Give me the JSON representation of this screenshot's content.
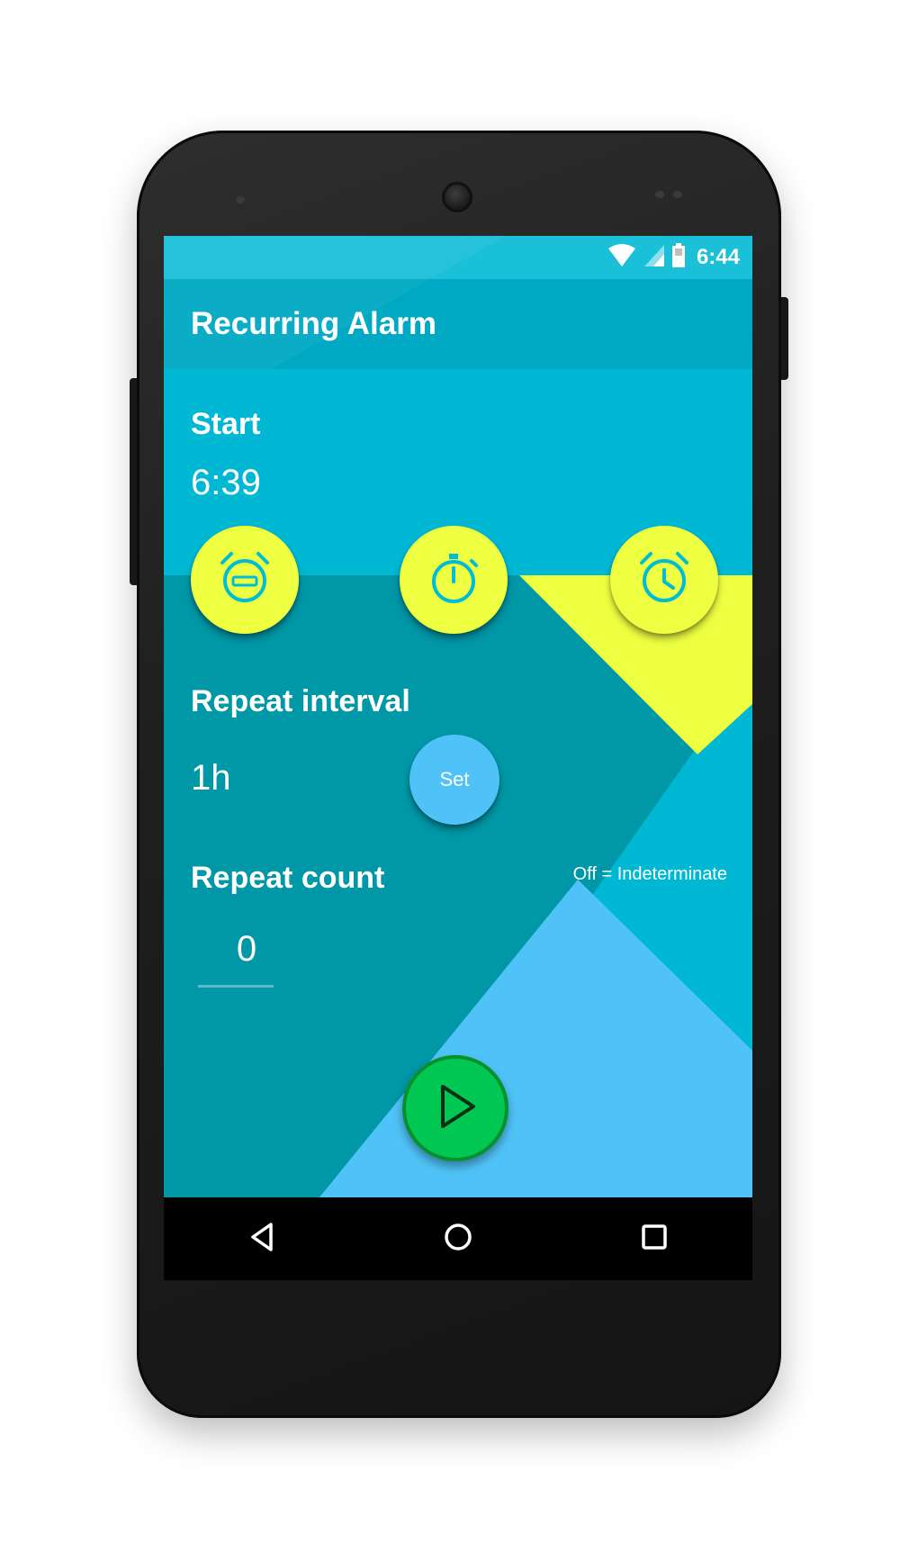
{
  "status_bar": {
    "time": "6:44",
    "icons": [
      "wifi-icon",
      "cell-signal-icon",
      "battery-icon"
    ]
  },
  "app_bar": {
    "title": "Recurring Alarm"
  },
  "start": {
    "label": "Start",
    "time": "6:39",
    "buttons": [
      "alarm-snooze-icon",
      "stopwatch-icon",
      "alarm-clock-icon"
    ]
  },
  "repeat_interval": {
    "label": "Repeat interval",
    "value": "1h",
    "set_button_label": "Set"
  },
  "repeat_count": {
    "label": "Repeat count",
    "value": "0",
    "indeterminate_label": "Off = Indeterminate"
  },
  "play_button": {
    "icon": "play-icon"
  },
  "nav_bar": {
    "buttons": [
      "back-icon",
      "home-icon",
      "recents-icon"
    ]
  },
  "colors": {
    "primary_dark": "#0097a7",
    "primary": "#00b8d4",
    "accent_yellow": "#eeff41",
    "light_blue": "#4fc3f7",
    "play_green": "#00c853"
  }
}
